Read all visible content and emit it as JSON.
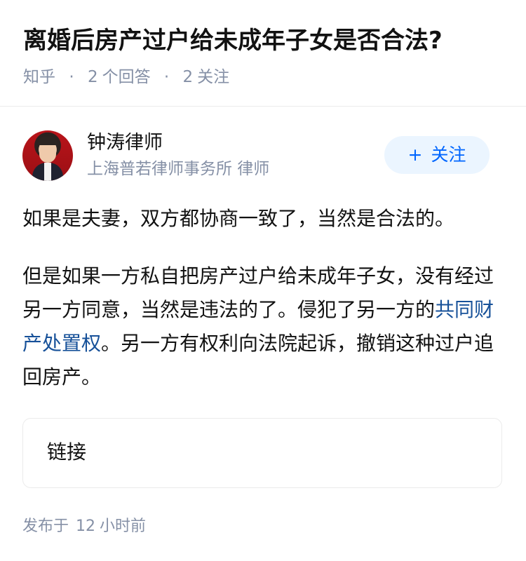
{
  "question": {
    "title": "离婚后房产过户给未成年子女是否合法?",
    "source": "知乎",
    "answer_count": "2",
    "answer_label": "个回答",
    "follower_count": "2",
    "follower_label": "关注"
  },
  "author": {
    "name": "钟涛律师",
    "headline": "上海普若律师事务所 律师",
    "follow_label": "关注",
    "follow_icon": "plus-icon"
  },
  "answer": {
    "paragraph_1": "如果是夫妻，双方都协商一致了，当然是合法的。",
    "paragraph_2_before": "但是如果一方私自把房产过户给未成年子女，没有经过另一方同意，当然是违法的了。侵犯了另一方的",
    "paragraph_2_link": "共同财产处置权",
    "paragraph_2_after": "。另一方有权利向法院起诉，撤销这种过户追回房产。"
  },
  "link_card": {
    "label": "链接"
  },
  "publish": {
    "prefix": "发布于",
    "value": "12",
    "unit": "小时前"
  },
  "colors": {
    "primary_text": "#121212",
    "secondary_text": "#8590a6",
    "accent": "#0066ff",
    "link": "#175199",
    "follow_bg": "#ebf5ff"
  }
}
